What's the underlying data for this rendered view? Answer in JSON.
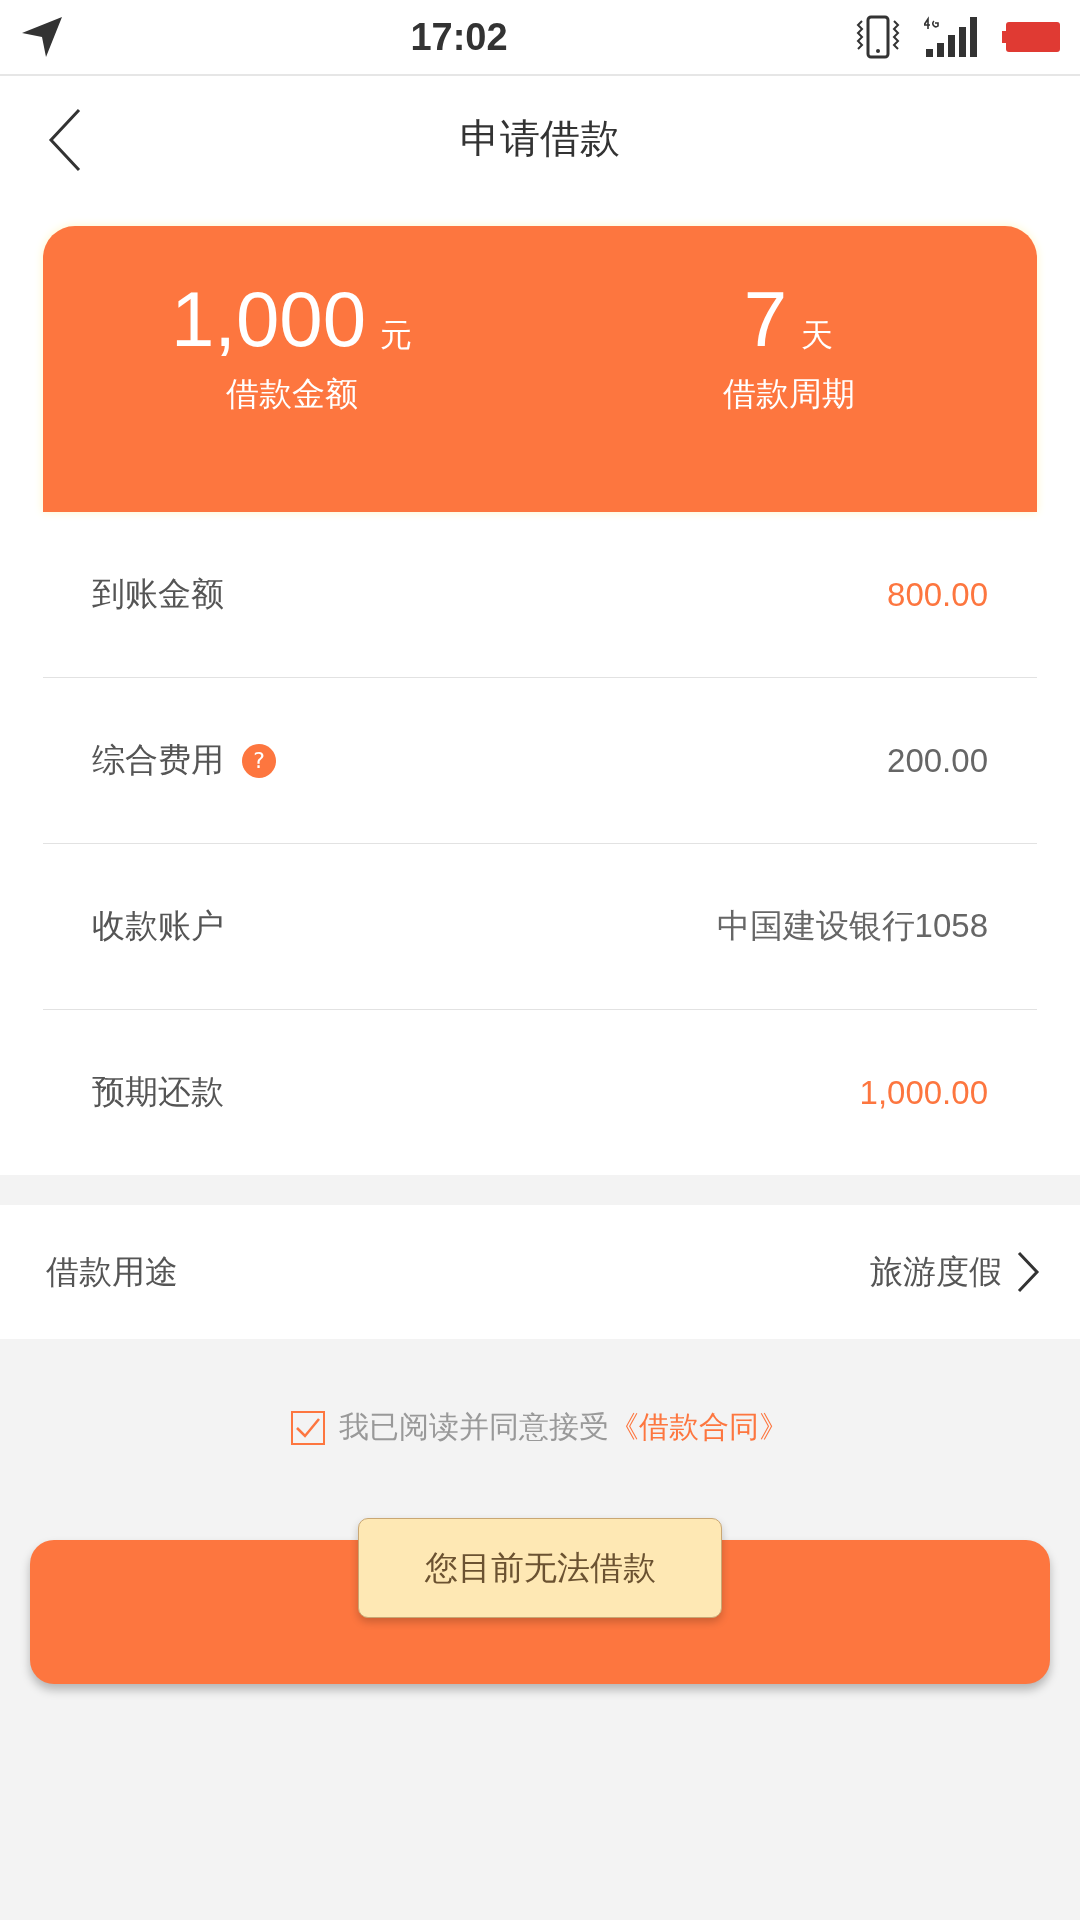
{
  "status_bar": {
    "time": "17:02"
  },
  "header": {
    "title": "申请借款"
  },
  "summary": [
    {
      "value": "1,000",
      "unit": "元",
      "label": "借款金额"
    },
    {
      "value": "7",
      "unit": "天",
      "label": "借款周期"
    }
  ],
  "details": [
    {
      "label": "到账金额",
      "value": "800.00",
      "highlight": true,
      "help": false
    },
    {
      "label": "综合费用",
      "value": "200.00",
      "highlight": false,
      "help": true,
      "help_mark": "?"
    },
    {
      "label": "收款账户",
      "value": "中国建设银行1058",
      "highlight": false,
      "help": false
    },
    {
      "label": "预期还款",
      "value": "1,000.00",
      "highlight": true,
      "help": false
    }
  ],
  "purpose": {
    "label": "借款用途",
    "value": "旅游度假"
  },
  "agreement": {
    "checked": true,
    "text": "我已阅读并同意接受",
    "link": "《借款合同》"
  },
  "toast": {
    "text": "您目前无法借款"
  }
}
